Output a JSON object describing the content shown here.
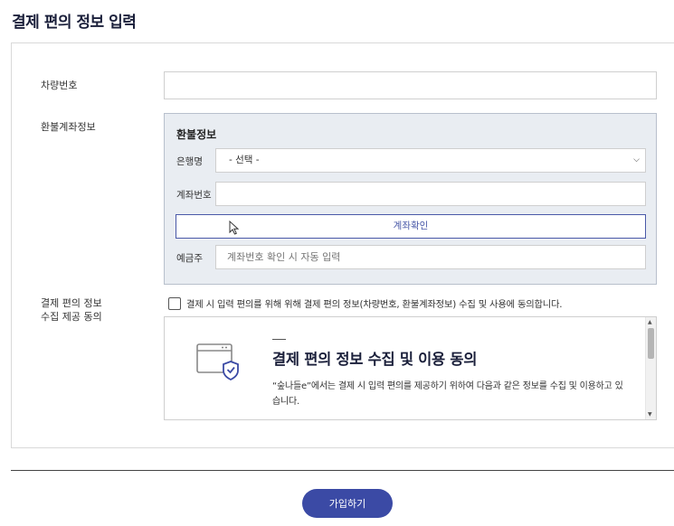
{
  "page": {
    "title": "결제 편의 정보 입력"
  },
  "vehicle": {
    "label": "차량번호",
    "value": ""
  },
  "refund": {
    "label": "환불계좌정보",
    "panel_title": "환불정보",
    "bank_label": "은행명",
    "bank_selected": "- 선택 -",
    "account_label": "계좌번호",
    "account_value": "",
    "verify_button": "계좌확인",
    "holder_label": "예금주",
    "holder_placeholder": "계좌번호 확인 시 자동 입력"
  },
  "consent": {
    "label_line1": "결제 편의 정보",
    "label_line2": "수집 제공 동의",
    "checkbox_text": "결제 시 입력 편의를 위해 위해 결제 편의 정보(차량번호, 환불계좌정보) 수집 및 사용에 동의합니다.",
    "checked": false,
    "terms_heading": "결제 편의 정보 수집 및 이용 동의",
    "terms_body": "“숲나들e”에서는 결제 시 입력 편의를 제공하기 위하여 다음과 같은 정보를 수집 및 이용하고 있습니다."
  },
  "footer": {
    "submit_button": "가입하기"
  },
  "colors": {
    "accent": "#3b4aa5",
    "panel_bg": "#e9edf2",
    "title": "#1a1f3a"
  }
}
